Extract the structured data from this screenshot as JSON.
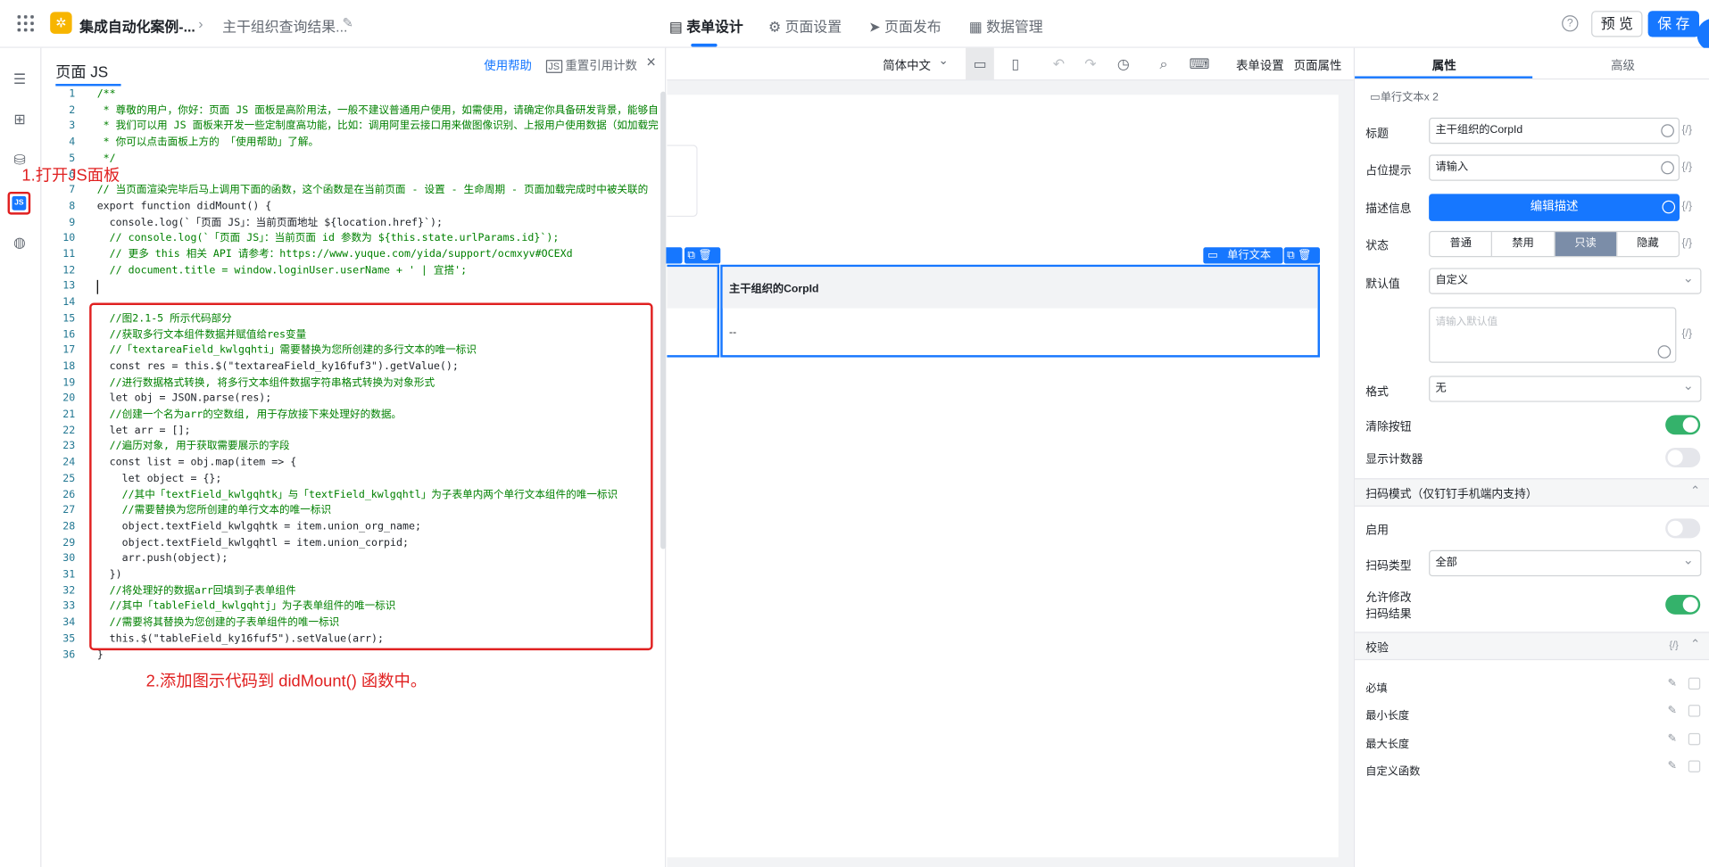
{
  "topbar": {
    "app_name": "集成自动化案例-...",
    "page_name": "主干组织查询结果...",
    "tabs": [
      "表单设计",
      "页面设置",
      "页面发布",
      "数据管理"
    ],
    "help": "?",
    "preview": "预 览",
    "save": "保 存"
  },
  "rail": {
    "js_label": "JS"
  },
  "js_panel": {
    "title": "页面 JS",
    "help_link": "使用帮助",
    "reset_link": "重置引用计数",
    "close": "×",
    "lines": [
      {
        "n": "1",
        "t": "/**"
      },
      {
        "n": "2",
        "t": " * 尊敬的用户，你好：页面 JS 面板是高阶用法，一般不建议普通用户使用，如需使用，请确定你具备研发背景，能够自"
      },
      {
        "n": "3",
        "t": " * 我们可以用 JS 面板来开发一些定制度高功能，比如：调用阿里云接口用来做图像识别、上报用户使用数据（如加载完"
      },
      {
        "n": "4",
        "t": " * 你可以点击面板上方的 「使用帮助」了解。"
      },
      {
        "n": "5",
        "t": " */"
      },
      {
        "n": "6",
        "t": ""
      },
      {
        "n": "7",
        "t": "// 当页面渲染完毕后马上调用下面的函数，这个函数是在当前页面 - 设置 - 生命周期 - 页面加载完成时中被关联的"
      },
      {
        "n": "8",
        "t": "export function didMount() {"
      },
      {
        "n": "9",
        "t": "  console.log(`「页面 JS」：当前页面地址 ${location.href}`);"
      },
      {
        "n": "10",
        "t": "  // console.log(`「页面 JS」：当前页面 id 参数为 ${this.state.urlParams.id}`);"
      },
      {
        "n": "11",
        "t": "  // 更多 this 相关 API 请参考：https://www.yuque.com/yida/support/ocmxyv#OCEXd"
      },
      {
        "n": "12",
        "t": "  // document.title = window.loginUser.userName + ' | 宜搭';"
      },
      {
        "n": "13",
        "t": ""
      },
      {
        "n": "14",
        "t": ""
      },
      {
        "n": "15",
        "t": "  //图2.1-5 所示代码部分"
      },
      {
        "n": "16",
        "t": "  //获取多行文本组件数据并赋值给res变量"
      },
      {
        "n": "17",
        "t": "  //「textareaField_kwlgqhti」需要替换为您所创建的多行文本的唯一标识"
      },
      {
        "n": "18",
        "t": "  const res = this.$(\"textareaField_ky16fuf3\").getValue();"
      },
      {
        "n": "19",
        "t": "  //进行数据格式转换, 将多行文本组件数据字符串格式转换为对象形式"
      },
      {
        "n": "20",
        "t": "  let obj = JSON.parse(res);"
      },
      {
        "n": "21",
        "t": "  //创建一个名为arr的空数组, 用于存放接下来处理好的数据。"
      },
      {
        "n": "22",
        "t": "  let arr = [];"
      },
      {
        "n": "23",
        "t": "  //遍历对象, 用于获取需要展示的字段"
      },
      {
        "n": "24",
        "t": "  const list = obj.map(item => {"
      },
      {
        "n": "25",
        "t": "    let object = {};"
      },
      {
        "n": "26",
        "t": "    //其中「textField_kwlgqhtk」与「textField_kwlgqhtl」为子表单内两个单行文本组件的唯一标识"
      },
      {
        "n": "27",
        "t": "    //需要替换为您所创建的单行文本的唯一标识"
      },
      {
        "n": "28",
        "t": "    object.textField_kwlgqhtk = item.union_org_name;"
      },
      {
        "n": "29",
        "t": "    object.textField_kwlgqhtl = item.union_corpid;"
      },
      {
        "n": "30",
        "t": "    arr.push(object);"
      },
      {
        "n": "31",
        "t": "  })"
      },
      {
        "n": "32",
        "t": "  //将处理好的数据arr回填到子表单组件"
      },
      {
        "n": "33",
        "t": "  //其中「tableField_kwlgqhtj」为子表单组件的唯一标识"
      },
      {
        "n": "34",
        "t": "  //需要将其替换为您创建的子表单组件的唯一标识"
      },
      {
        "n": "35",
        "t": "  this.$(\"tableField_ky16fuf5\").setValue(arr);"
      },
      {
        "n": "36",
        "t": "}"
      }
    ]
  },
  "annotations": {
    "step1": "1.打开JS面板",
    "step2": "2.添加图示代码到 didMount() 函数中。"
  },
  "canvas_toolbar": {
    "language": "简体中文",
    "form_settings": "表单设置",
    "page_props": "页面属性"
  },
  "canvas": {
    "component_tag": "单行文本",
    "column_header": "主干组织的CorpId",
    "cell_value": "--"
  },
  "props": {
    "tabs": [
      "属性",
      "高级"
    ],
    "component_type": "单行文本x 2",
    "title_label": "标题",
    "title_value": "主干组织的CorpId",
    "placeholder_label": "占位提示",
    "placeholder_value": "请输入",
    "desc_label": "描述信息",
    "desc_button": "编辑描述",
    "status_label": "状态",
    "status_options": [
      "普通",
      "禁用",
      "只读",
      "隐藏"
    ],
    "status_selected": "只读",
    "default_label": "默认值",
    "default_value": "自定义",
    "default_placeholder": "请输入默认值",
    "format_label": "格式",
    "format_value": "无",
    "clear_label": "清除按钮",
    "clear_on": true,
    "counter_label": "显示计数器",
    "counter_on": false,
    "scan_section": "扫码模式（仅钉钉手机端内支持）",
    "enable_label": "启用",
    "enable_on": false,
    "scan_type_label": "扫码类型",
    "scan_type_value": "全部",
    "allow_edit_label_1": "允许修改",
    "allow_edit_label_2": "扫码结果",
    "allow_edit_on": true,
    "validate_section": "校验",
    "validate_rules": [
      "必填",
      "最小长度",
      "最大长度",
      "自定义函数"
    ],
    "expr_icon": "{/}"
  },
  "colors": {
    "accent": "#1677ff",
    "annotation": "#e02020",
    "toggle_on": "#34b26b"
  }
}
